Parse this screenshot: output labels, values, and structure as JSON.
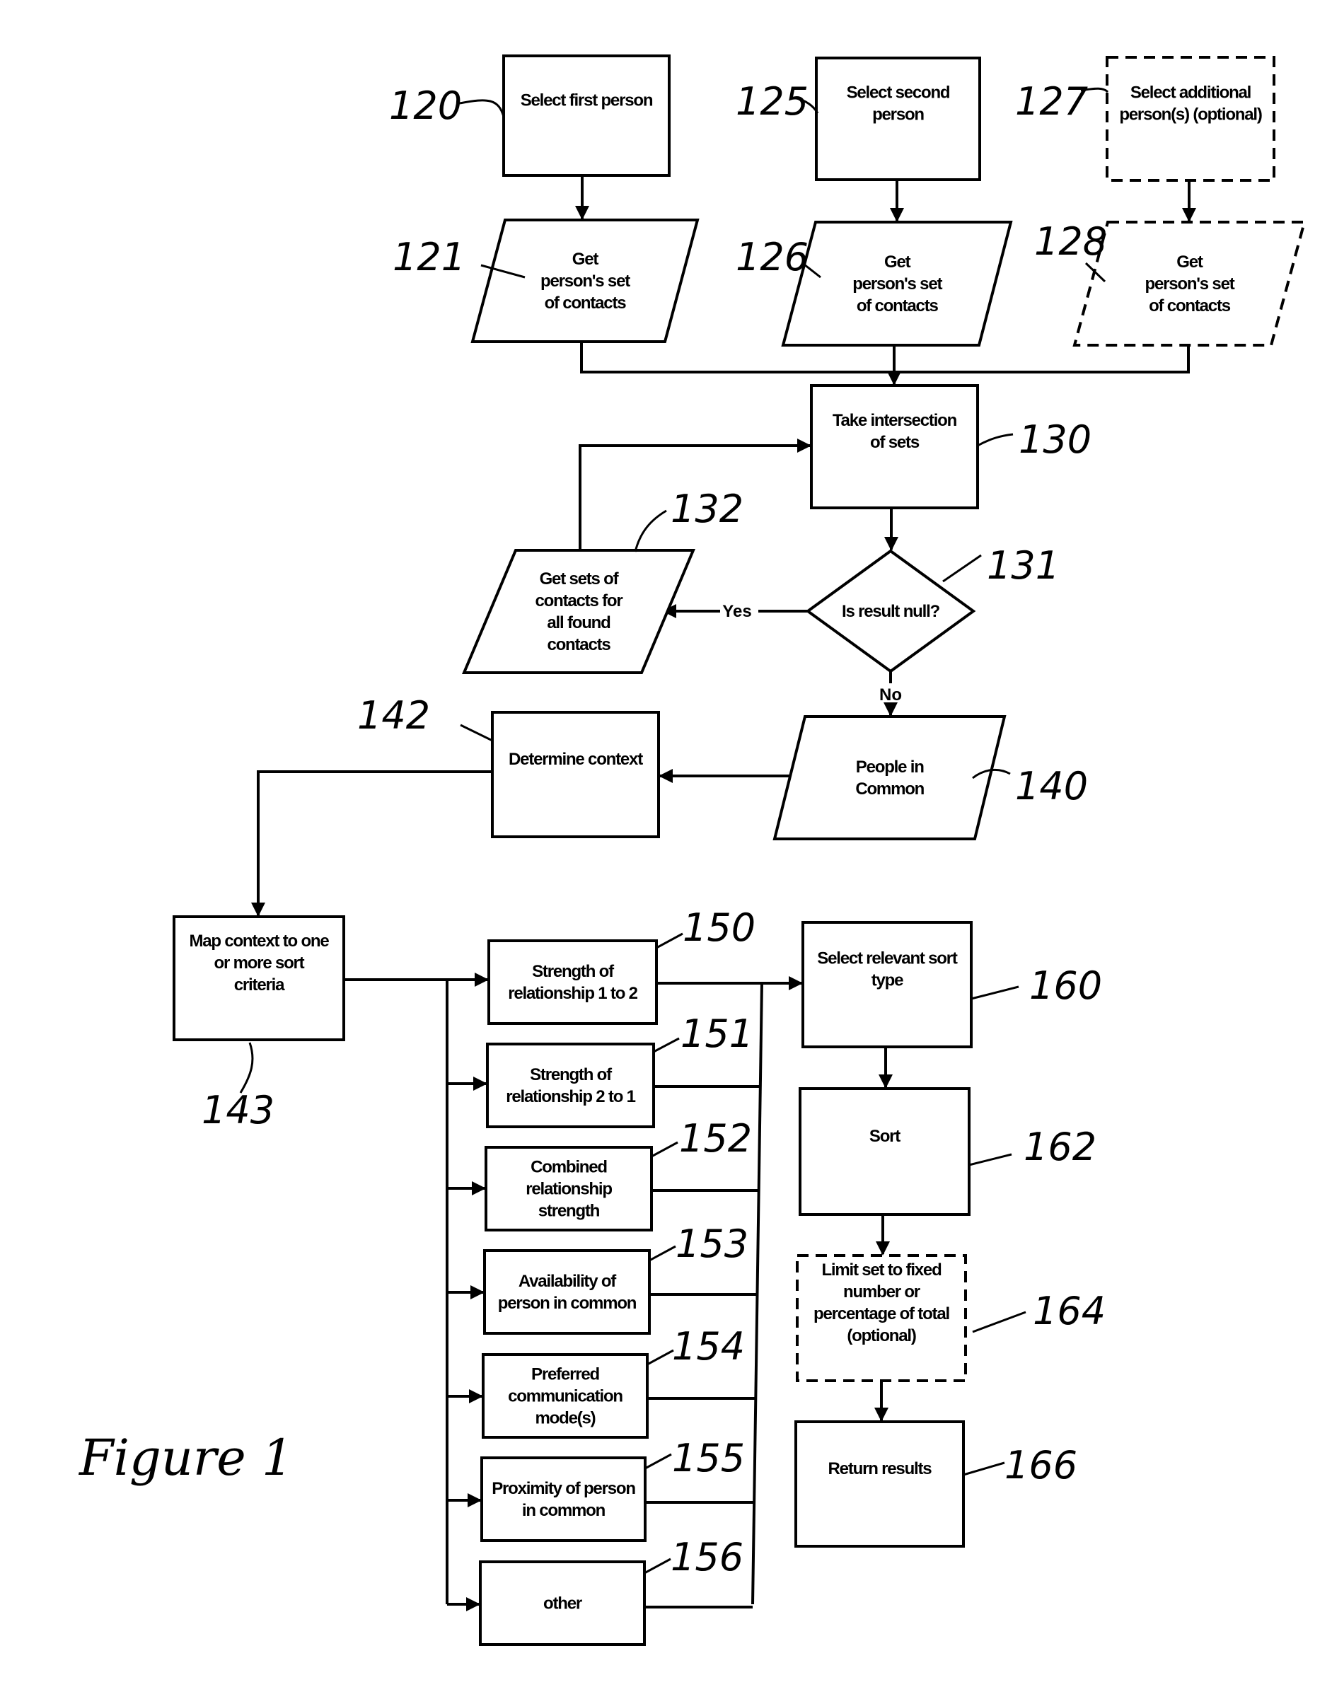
{
  "figure_label": "Figure 1",
  "nodes": {
    "n120": {
      "ref": "120",
      "lines": [
        "Select first person"
      ],
      "style": "solid",
      "shape": "rect"
    },
    "n125": {
      "ref": "125",
      "lines": [
        "Select second",
        "person"
      ],
      "style": "solid",
      "shape": "rect"
    },
    "n127": {
      "ref": "127",
      "lines": [
        "Select additional",
        "person(s) (optional)"
      ],
      "style": "dashed",
      "shape": "rect"
    },
    "n121": {
      "ref": "121",
      "lines": [
        "Get",
        "person's set",
        "of contacts"
      ],
      "style": "solid",
      "shape": "parallelogram"
    },
    "n126": {
      "ref": "126",
      "lines": [
        "Get",
        "person's set",
        "of contacts"
      ],
      "style": "solid",
      "shape": "parallelogram"
    },
    "n128": {
      "ref": "128",
      "lines": [
        "Get",
        "person's set",
        "of contacts"
      ],
      "style": "dashed",
      "shape": "parallelogram"
    },
    "n130": {
      "ref": "130",
      "lines": [
        "Take intersection",
        "of sets"
      ],
      "style": "solid",
      "shape": "rect"
    },
    "n131": {
      "ref": "131",
      "lines": [
        "Is result null?"
      ],
      "style": "solid",
      "shape": "diamond"
    },
    "n132": {
      "ref": "132",
      "lines": [
        "Get sets of",
        "contacts for",
        "all found",
        "contacts"
      ],
      "style": "solid",
      "shape": "parallelogram"
    },
    "n140": {
      "ref": "140",
      "lines": [
        "People in",
        "Common"
      ],
      "style": "solid",
      "shape": "parallelogram"
    },
    "n142": {
      "ref": "142",
      "lines": [
        "Determine context"
      ],
      "style": "solid",
      "shape": "rect"
    },
    "n143": {
      "ref": "143",
      "lines": [
        "Map context to one",
        "or more sort",
        "criteria"
      ],
      "style": "solid",
      "shape": "rect"
    },
    "n150": {
      "ref": "150",
      "lines": [
        "Strength of",
        "relationship 1 to 2"
      ],
      "style": "solid",
      "shape": "rect"
    },
    "n151": {
      "ref": "151",
      "lines": [
        "Strength of",
        "relationship 2 to 1"
      ],
      "style": "solid",
      "shape": "rect"
    },
    "n152": {
      "ref": "152",
      "lines": [
        "Combined",
        "relationship",
        "strength"
      ],
      "style": "solid",
      "shape": "rect"
    },
    "n153": {
      "ref": "153",
      "lines": [
        "Availability of",
        "person in common"
      ],
      "style": "solid",
      "shape": "rect"
    },
    "n154": {
      "ref": "154",
      "lines": [
        "Preferred",
        "communication",
        "mode(s)"
      ],
      "style": "solid",
      "shape": "rect"
    },
    "n155": {
      "ref": "155",
      "lines": [
        "Proximity of person",
        "in common"
      ],
      "style": "solid",
      "shape": "rect"
    },
    "n156": {
      "ref": "156",
      "lines": [
        "other"
      ],
      "style": "solid",
      "shape": "rect"
    },
    "n160": {
      "ref": "160",
      "lines": [
        "Select relevant sort",
        "type"
      ],
      "style": "solid",
      "shape": "rect"
    },
    "n162": {
      "ref": "162",
      "lines": [
        "Sort"
      ],
      "style": "solid",
      "shape": "rect"
    },
    "n164": {
      "ref": "164",
      "lines": [
        "Limit set to fixed",
        "number or",
        "percentage of total",
        "(optional)"
      ],
      "style": "dashed",
      "shape": "rect"
    },
    "n166": {
      "ref": "166",
      "lines": [
        "Return results"
      ],
      "style": "solid",
      "shape": "rect"
    }
  },
  "edges": {
    "yes_label": "Yes",
    "no_label": "No"
  },
  "connections": [
    [
      "120",
      "121"
    ],
    [
      "125",
      "126"
    ],
    [
      "127",
      "128"
    ],
    [
      "121",
      "130"
    ],
    [
      "126",
      "130"
    ],
    [
      "128",
      "130"
    ],
    [
      "130",
      "131"
    ],
    [
      "131",
      "132",
      "Yes"
    ],
    [
      "132",
      "130"
    ],
    [
      "131",
      "140",
      "No"
    ],
    [
      "140",
      "142"
    ],
    [
      "142",
      "143"
    ],
    [
      "143",
      "150"
    ],
    [
      "143",
      "151"
    ],
    [
      "143",
      "152"
    ],
    [
      "143",
      "153"
    ],
    [
      "143",
      "154"
    ],
    [
      "143",
      "155"
    ],
    [
      "143",
      "156"
    ],
    [
      "150",
      "160"
    ],
    [
      "151",
      "160"
    ],
    [
      "152",
      "160"
    ],
    [
      "153",
      "160"
    ],
    [
      "154",
      "160"
    ],
    [
      "155",
      "160"
    ],
    [
      "156",
      "160"
    ],
    [
      "160",
      "162"
    ],
    [
      "162",
      "164"
    ],
    [
      "164",
      "166"
    ]
  ]
}
